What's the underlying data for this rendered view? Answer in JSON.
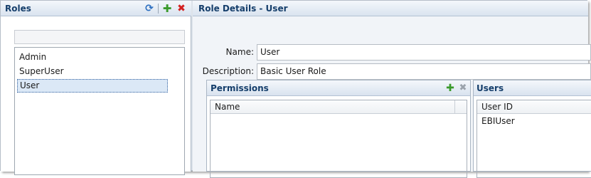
{
  "roles": {
    "title": "Roles",
    "filter_value": "",
    "items": [
      "Admin",
      "SuperUser",
      "User"
    ],
    "selected": "User",
    "icons": [
      "refresh-icon",
      "add-icon",
      "delete-icon"
    ]
  },
  "details": {
    "title": "Role Details - User",
    "name_label": "Name:",
    "name_value": "User",
    "description_label": "Description:",
    "description_value": "Basic User Role"
  },
  "permissions": {
    "title": "Permissions",
    "columns": [
      "Name"
    ],
    "rows": [],
    "icons": [
      "add-icon",
      "remove-icon"
    ]
  },
  "users": {
    "title": "Users",
    "columns": [
      "User ID"
    ],
    "rows": [
      "EBIUser"
    ]
  },
  "colors": {
    "header_text": "#153e6b",
    "add_green": "#3a9a2b",
    "delete_red": "#d32020",
    "selection": "#dbe8f6"
  }
}
